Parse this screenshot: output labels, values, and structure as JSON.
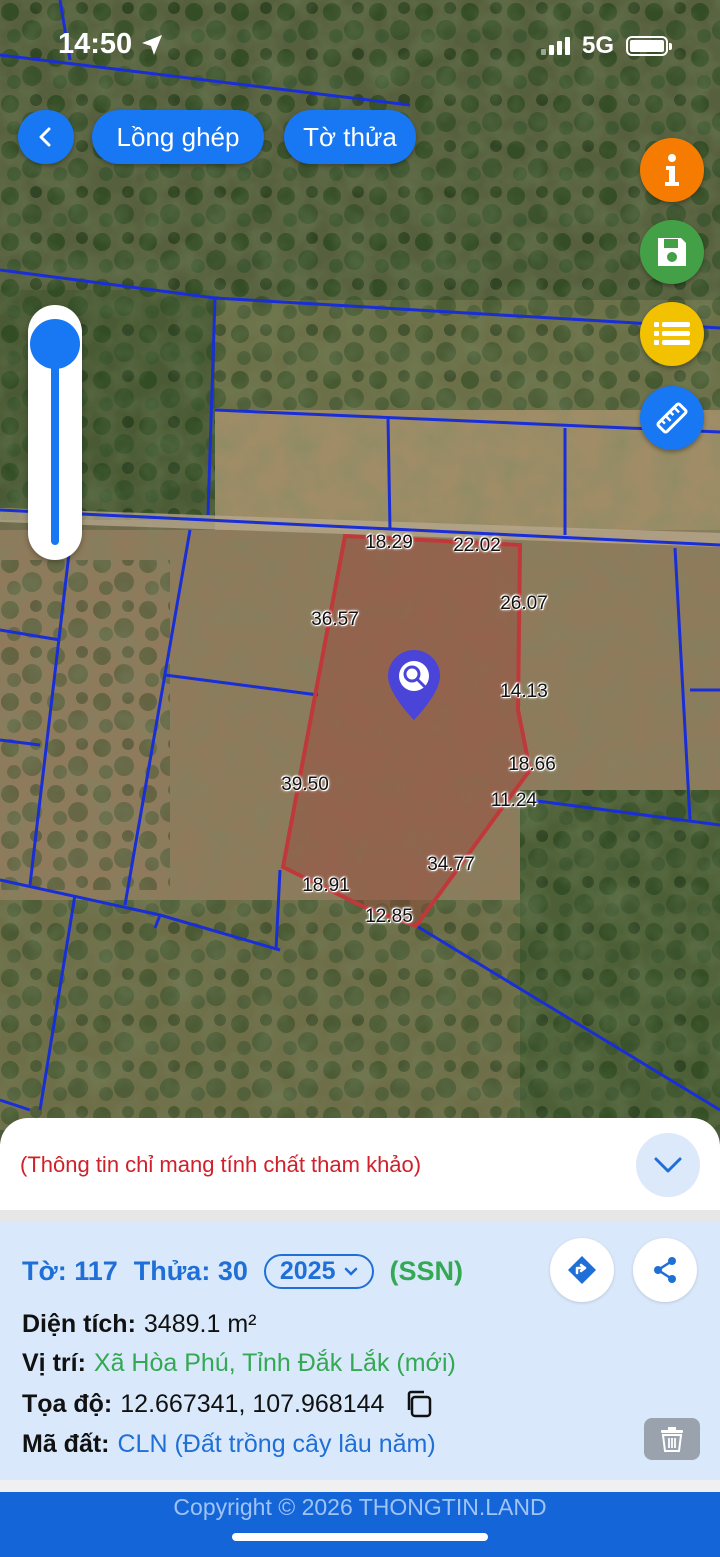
{
  "status": {
    "time": "14:50",
    "network": "5G"
  },
  "nav": {
    "back_label": "<",
    "overlay_label": "Lồng ghép",
    "sheet_label": "Tờ thửa"
  },
  "side_actions": [
    {
      "name": "info-icon",
      "color": "#f57c00"
    },
    {
      "name": "save-icon",
      "color": "#43a047"
    },
    {
      "name": "list-icon",
      "color": "#f2c200"
    },
    {
      "name": "measure-icon",
      "color": "#1877f2"
    }
  ],
  "parcel_dimensions": {
    "d1": "18.29",
    "d2": "22.02",
    "d3": "26.07",
    "d4": "36.57",
    "d5": "14.13",
    "d6": "18.66",
    "d7": "39.50",
    "d8": "11.24",
    "d9": "34.77",
    "d10": "18.91",
    "d11": "12.85"
  },
  "notice": "(Thông tin chỉ mang tính chất tham khảo)",
  "parcel": {
    "sheet_label": "Tờ:",
    "sheet_value": "117",
    "plot_label": "Thửa:",
    "plot_value": "30",
    "year": "2025",
    "type_code": "(SSN)",
    "area_label": "Diện tích:",
    "area_value": "3489.1 m²",
    "location_label": "Vị trí:",
    "location_value": "Xã Hòa Phú, Tỉnh Đắk Lắk (mới)",
    "coords_label": "Tọa độ:",
    "coords_value": "12.667341, 107.968144",
    "landcode_label": "Mã đất:",
    "landcode_value": "CLN (Đất trồng cây lâu năm)"
  },
  "footer": {
    "copyright": "Copyright © 2026 THONGTIN.LAND"
  }
}
